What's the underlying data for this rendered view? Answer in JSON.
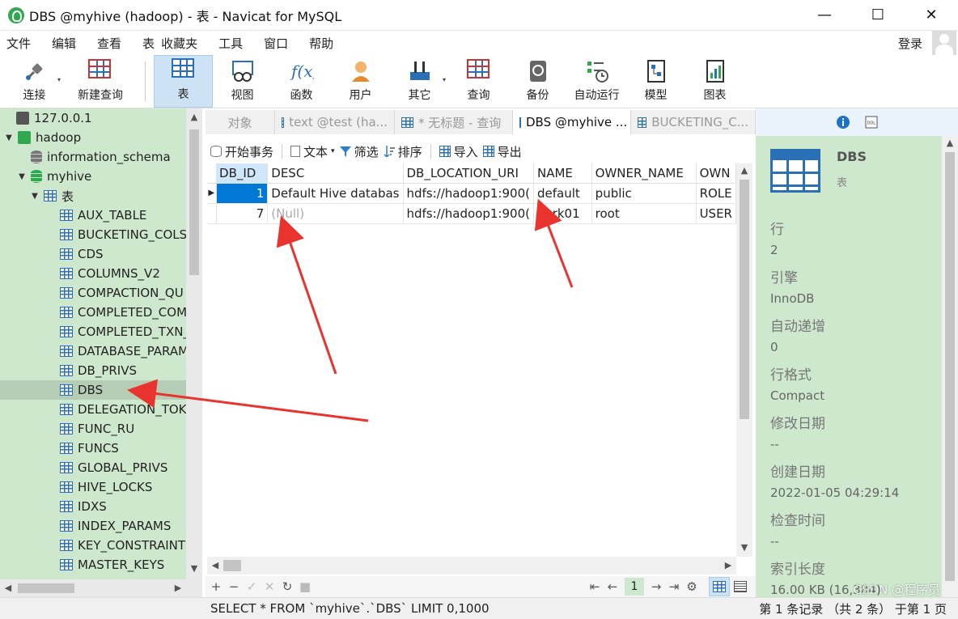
{
  "window": {
    "title": "DBS @myhive (hadoop) - 表 - Navicat for MySQL",
    "minimize": "—",
    "maximize": "☐",
    "close": "✕"
  },
  "menu": {
    "items": [
      "文件",
      "编辑",
      "查看",
      "表",
      "收藏夹",
      "工具",
      "窗口",
      "帮助"
    ],
    "login": "登录"
  },
  "toolbar": {
    "connect": "连接",
    "new_query": "新建查询",
    "table": "表",
    "view": "视图",
    "function": "函数",
    "user": "用户",
    "other": "其它",
    "query": "查询",
    "backup": "备份",
    "auto_run": "自动运行",
    "model": "模型",
    "chart": "图表"
  },
  "sidebar": {
    "connections": [
      {
        "label": "127.0.0.1"
      },
      {
        "label": "hadoop"
      }
    ],
    "databases": [
      {
        "label": "information_schema"
      },
      {
        "label": "myhive"
      }
    ],
    "tables_node": "表",
    "tables": [
      "AUX_TABLE",
      "BUCKETING_COLS",
      "CDS",
      "COLUMNS_V2",
      "COMPACTION_QU",
      "COMPLETED_COM",
      "COMPLETED_TXN_",
      "DATABASE_PARAM",
      "DB_PRIVS",
      "DBS",
      "DELEGATION_TOKE",
      "FUNC_RU",
      "FUNCS",
      "GLOBAL_PRIVS",
      "HIVE_LOCKS",
      "IDXS",
      "INDEX_PARAMS",
      "KEY_CONSTRAINTS",
      "MASTER_KEYS"
    ],
    "selected_table": "DBS"
  },
  "tabs": [
    {
      "label": "对象",
      "active": false
    },
    {
      "label": "text @test (ha...",
      "active": false
    },
    {
      "label": "* 无标题 - 查询",
      "active": false
    },
    {
      "label": "DBS @myhive ...",
      "active": true
    },
    {
      "label": "BUCKETING_C...",
      "active": false
    }
  ],
  "data_toolbar": {
    "begin_transaction": "开始事务",
    "text": "文本",
    "filter": "筛选",
    "sort": "排序",
    "import": "导入",
    "export": "导出"
  },
  "grid": {
    "columns": [
      "DB_ID",
      "DESC",
      "DB_LOCATION_URI",
      "NAME",
      "OWNER_NAME",
      "OWN"
    ],
    "rows": [
      [
        "1",
        "Default Hive databas",
        "hdfs://hadoop1:900(",
        "default",
        "public",
        "ROLE"
      ],
      [
        "7",
        "(Null)",
        "hdfs://hadoop1:900(",
        "park01",
        "root",
        "USER"
      ]
    ]
  },
  "nav": {
    "add": "+",
    "remove": "−",
    "apply": "✓",
    "discard": "✕",
    "refresh": "↻",
    "stop": "■",
    "first": "⇤",
    "prev": "←",
    "page": "1",
    "next": "→",
    "last": "⇥",
    "settings": "⚙"
  },
  "info": {
    "name": "DBS",
    "type": "表",
    "props": [
      {
        "label": "行",
        "value": "2"
      },
      {
        "label": "引擎",
        "value": "InnoDB"
      },
      {
        "label": "自动递增",
        "value": "0"
      },
      {
        "label": "行格式",
        "value": "Compact"
      },
      {
        "label": "修改日期",
        "value": "--"
      },
      {
        "label": "创建日期",
        "value": "2022-01-05 04:29:14"
      },
      {
        "label": "检查时间",
        "value": "--"
      },
      {
        "label": "索引长度",
        "value": "16.00 KB (16,384)"
      }
    ]
  },
  "status": {
    "sql": "SELECT * FROM `myhive`.`DBS` LIMIT 0,1000",
    "records": "第 1 条记录 （共 2 条） 于第 1 页"
  },
  "watermark": "CSDN @程序员",
  "colors": {
    "sidebar_bg": "#cde8cd",
    "selection": "#0078d7",
    "annotation_arrow": "#e8332f"
  }
}
